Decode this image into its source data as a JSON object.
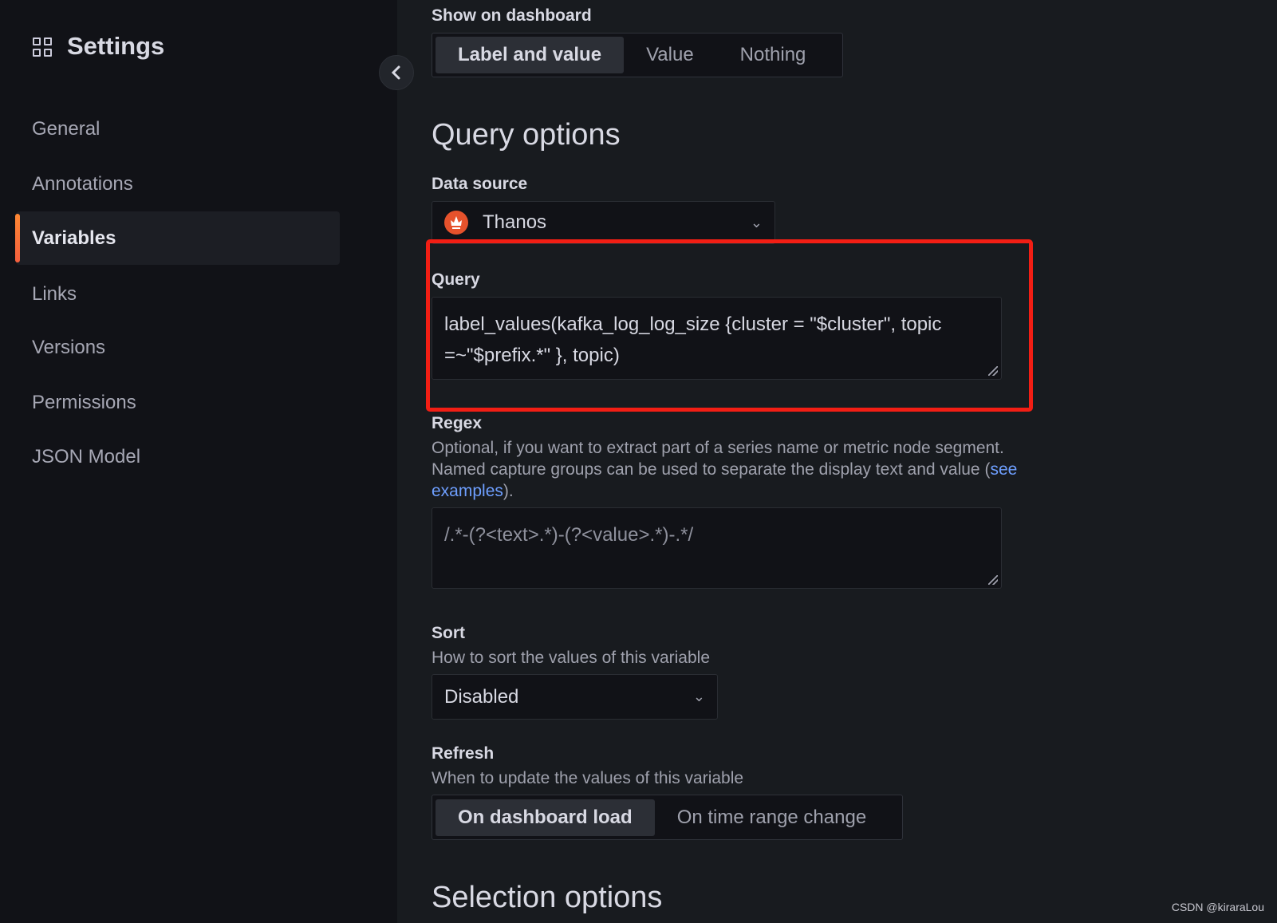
{
  "sidebar": {
    "title": "Settings",
    "icon": "apps-grid-icon",
    "items": [
      {
        "label": "General",
        "active": false
      },
      {
        "label": "Annotations",
        "active": false
      },
      {
        "label": "Variables",
        "active": true
      },
      {
        "label": "Links",
        "active": false
      },
      {
        "label": "Versions",
        "active": false
      },
      {
        "label": "Permissions",
        "active": false
      },
      {
        "label": "JSON Model",
        "active": false
      }
    ],
    "accent": "#ff8833"
  },
  "show_on_dashboard": {
    "label": "Show on dashboard",
    "options": [
      "Label and value",
      "Value",
      "Nothing"
    ],
    "selected": "Label and value"
  },
  "query_options": {
    "heading": "Query options",
    "data_source": {
      "label": "Data source",
      "value": "Thanos",
      "icon": "prometheus-icon"
    },
    "query": {
      "label": "Query",
      "value": "label_values(kafka_log_log_size {cluster = \"$cluster\", topic =~\"$prefix.*\" }, topic)"
    },
    "regex": {
      "label": "Regex",
      "desc_prefix": "Optional, if you want to extract part of a series name or metric node segment. Named capture groups can be used to separate the display text and value (",
      "link": "see examples",
      "desc_suffix": ").",
      "placeholder": "/.*-(?<text>.*)-(?<value>.*)-.*/"
    },
    "sort": {
      "label": "Sort",
      "desc": "How to sort the values of this variable",
      "value": "Disabled"
    },
    "refresh": {
      "label": "Refresh",
      "desc": "When to update the values of this variable",
      "options": [
        "On dashboard load",
        "On time range change"
      ],
      "selected": "On dashboard load"
    }
  },
  "selection_options": {
    "heading": "Selection options"
  },
  "highlight_color": "#f21e14",
  "watermark": "CSDN @kiraraLou"
}
